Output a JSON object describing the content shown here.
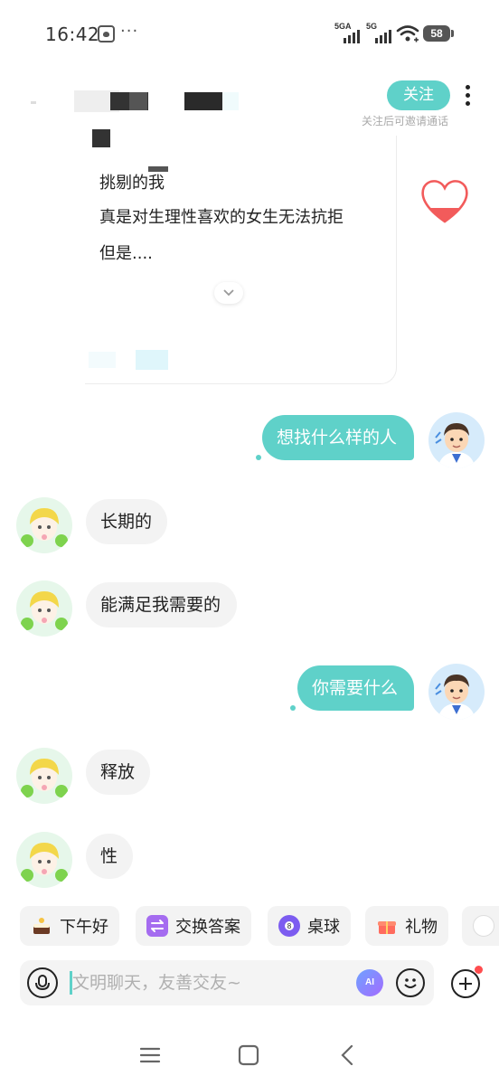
{
  "status_bar": {
    "time": "16:42",
    "network_1": "5GA",
    "network_2": "5G",
    "battery": "58"
  },
  "header": {
    "follow_label": "关注",
    "follow_hint": "关注后可邀请通话"
  },
  "profile_card": {
    "lines": [
      "挑剔的我",
      "真是对生理性喜欢的女生无法抗拒",
      "但是...."
    ]
  },
  "messages": [
    {
      "side": "out",
      "text": "想找什么样的人"
    },
    {
      "side": "in",
      "text": "长期的"
    },
    {
      "side": "in",
      "text": "能满足我需要的"
    },
    {
      "side": "out",
      "text": "你需要什么"
    },
    {
      "side": "in",
      "text": "释放"
    },
    {
      "side": "in",
      "text": "性"
    }
  ],
  "quick_replies": [
    {
      "label": "下午好",
      "icon": "cake-icon"
    },
    {
      "label": "交换答案",
      "icon": "swap-icon"
    },
    {
      "label": "桌球",
      "icon": "billiard-ball-icon"
    },
    {
      "label": "礼物",
      "icon": "gift-icon"
    }
  ],
  "input": {
    "placeholder": "文明聊天，友善交友~",
    "ai_label": "AI"
  },
  "colors": {
    "accent": "#5fd1c9",
    "bubble_in": "#f3f3f3",
    "notification": "#ff4d4f"
  }
}
